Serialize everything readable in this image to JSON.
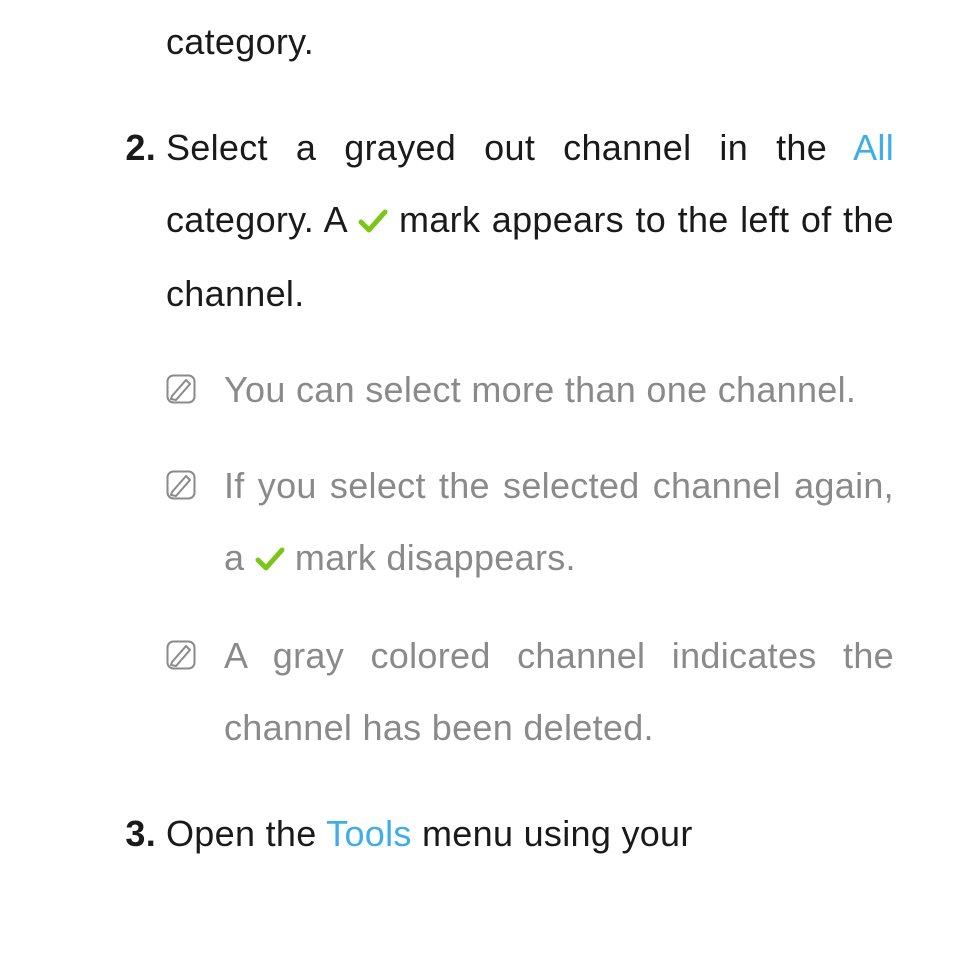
{
  "colors": {
    "link": "#3DAEEA",
    "noteText": "#8a8a8a",
    "bodyText": "#1a1a1a",
    "checkGreen": "#7BC717"
  },
  "trailingLine": "category.",
  "steps": [
    {
      "number": "2.",
      "parts": {
        "a": "Select a grayed out channel in the ",
        "link": "All",
        "b": " category. A ",
        "c": " mark appears to the left of the channel."
      },
      "notes": [
        {
          "text": "You can select more than one channel."
        },
        {
          "parts": {
            "a": "If you select the selected channel again, a ",
            "b": " mark disappears."
          }
        },
        {
          "text": "A gray colored channel indicates the channel has been deleted."
        }
      ]
    },
    {
      "number": "3.",
      "parts": {
        "a": "Open the ",
        "link": "Tools",
        "b": " menu using your"
      }
    }
  ]
}
